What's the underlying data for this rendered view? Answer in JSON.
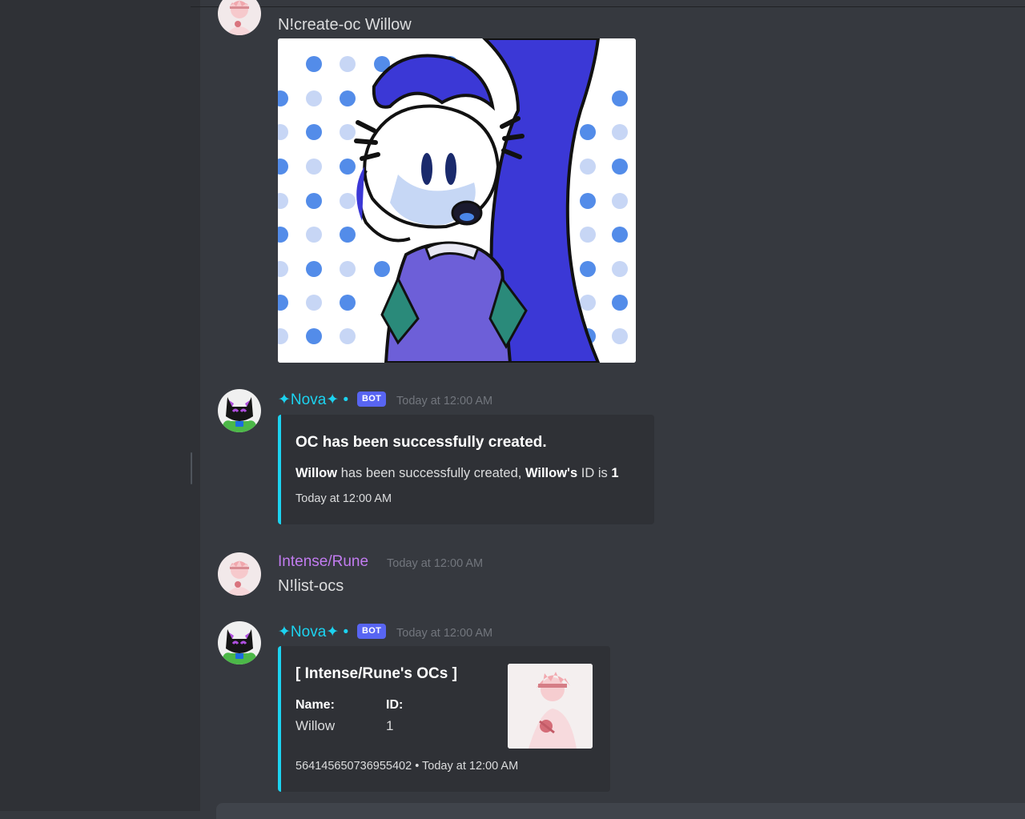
{
  "messages": {
    "first": {
      "text": "N!create-oc Willow"
    },
    "bot1": {
      "username": "✦Nova✦ •",
      "badge": "BOT",
      "timestamp": "Today at 12:00 AM",
      "embed": {
        "title": "OC has been successfully created.",
        "desc_name": "Willow",
        "desc_mid": "has been successfully created,",
        "desc_id_label": "Willow's",
        "desc_id_mid": "ID is",
        "desc_id_value": "1",
        "footer": "Today at 12:00 AM"
      }
    },
    "user2": {
      "username": "Intense/Rune",
      "timestamp": "Today at 12:00 AM",
      "text": "N!list-ocs"
    },
    "bot2": {
      "username": "✦Nova✦ •",
      "badge": "BOT",
      "timestamp": "Today at 12:00 AM",
      "embed": {
        "title": "[ Intense/Rune's OCs ]",
        "field_name_label": "Name:",
        "field_name_value": "Willow",
        "field_id_label": "ID:",
        "field_id_value": "1",
        "footer_id": "564145650736955402",
        "footer_sep": "•",
        "footer_time": "Today at 12:00 AM"
      }
    }
  },
  "colors": {
    "background": "#36393f",
    "sidebar": "#2f3136",
    "embed_bg": "#2f3136",
    "embed_accent": "#1cd3f0",
    "bot_name": "#1cd3f0",
    "user_name": "#c27cf0",
    "badge": "#5865f2",
    "timestamp": "#72767d"
  },
  "icons": {
    "user_avatar": "pink-anime-avatar",
    "bot_avatar": "black-cat-avatar"
  }
}
